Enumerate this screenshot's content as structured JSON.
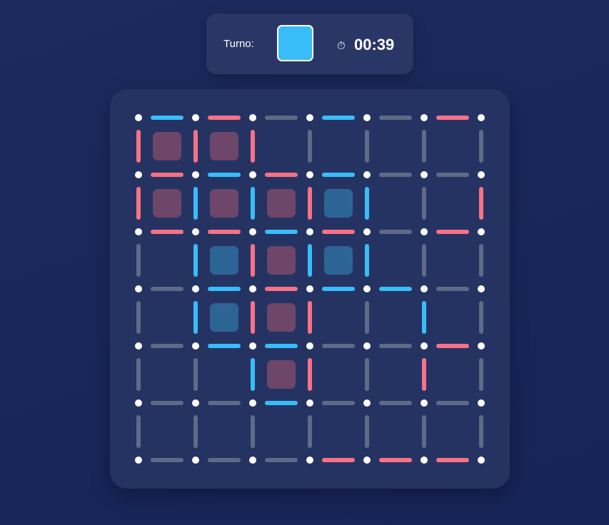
{
  "hud": {
    "turn_label": "Turno:",
    "current_turn_color": "#38bdf8",
    "timer_icon": "stopwatch-icon",
    "timer_value": "00:39"
  },
  "colors": {
    "blue": "#38bdf8",
    "red": "#f87185",
    "empty": "#5d6b87",
    "dot": "#ffffff",
    "box_blue": "#2d6496",
    "box_red": "#6d4669"
  },
  "board": {
    "rows": 6,
    "cols": 6,
    "horizontal_lines": [
      [
        "blue",
        "red",
        "empty",
        "blue",
        "empty",
        "red"
      ],
      [
        "red",
        "blue",
        "red",
        "blue",
        "empty",
        "empty"
      ],
      [
        "red",
        "red",
        "blue",
        "red",
        "empty",
        "red"
      ],
      [
        "empty",
        "blue",
        "red",
        "blue",
        "blue",
        "empty"
      ],
      [
        "empty",
        "blue",
        "blue",
        "empty",
        "empty",
        "red"
      ],
      [
        "empty",
        "empty",
        "blue",
        "empty",
        "empty",
        "empty"
      ],
      [
        "empty",
        "empty",
        "empty",
        "red",
        "red",
        "red"
      ]
    ],
    "vertical_lines": [
      [
        "red",
        "red",
        "red",
        "empty",
        "empty",
        "empty",
        "empty"
      ],
      [
        "red",
        "blue",
        "blue",
        "red",
        "blue",
        "empty",
        "red"
      ],
      [
        "empty",
        "blue",
        "red",
        "blue",
        "blue",
        "empty",
        "empty"
      ],
      [
        "empty",
        "blue",
        "red",
        "red",
        "empty",
        "blue",
        "empty"
      ],
      [
        "empty",
        "empty",
        "blue",
        "red",
        "empty",
        "red",
        "empty"
      ],
      [
        "empty",
        "empty",
        "empty",
        "empty",
        "empty",
        "empty",
        "empty"
      ]
    ],
    "boxes": [
      [
        "red",
        "red",
        null,
        null,
        null,
        null
      ],
      [
        "red",
        "red",
        "red",
        "blue",
        null,
        null
      ],
      [
        null,
        "blue",
        "red",
        "blue",
        null,
        null
      ],
      [
        null,
        "blue",
        "red",
        null,
        null,
        null
      ],
      [
        null,
        null,
        "red",
        null,
        null,
        null
      ],
      [
        null,
        null,
        null,
        null,
        null,
        null
      ]
    ]
  }
}
